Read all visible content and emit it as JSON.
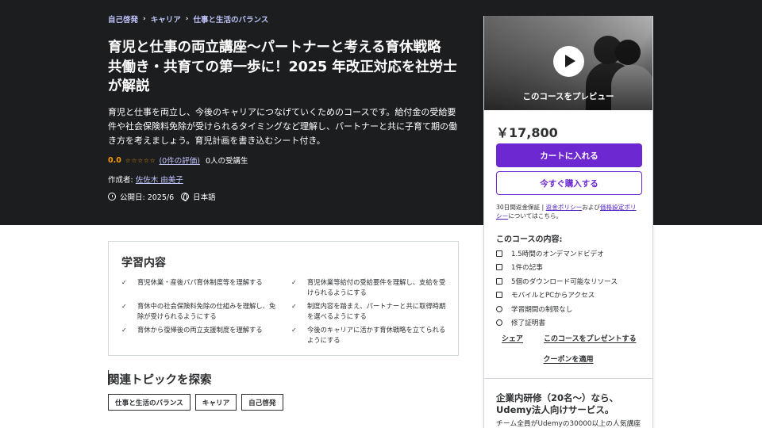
{
  "breadcrumb": [
    "自己啓発",
    "キャリア",
    "仕事と生活のバランス"
  ],
  "course": {
    "title": "育児と仕事の両立講座〜パートナーと考える育休戦略　共働き・共育ての第一歩に！2025 年改正対応を社労士が解説",
    "description": "育児と仕事を両立し、今後のキャリアにつなげていくためのコースです。給付金の受給要件や社会保険料免除が受けられるタイミングなど理解し、パートナーと共に子育て期の働き方を考えましょう。育児計画を書き込むシート付き。",
    "rating": "0.0",
    "stars": "☆☆☆☆☆",
    "rating_count": "(0件の評価)",
    "students": "0人の受講生",
    "author_label": "作成者: ",
    "author": "佐佐木 由美子",
    "published": "公開日: 2025/6",
    "language": "日本語"
  },
  "sidebar": {
    "preview_label": "このコースをプレビュー",
    "price": "￥17,800",
    "add_to_cart": "カートに入れる",
    "buy_now": "今すぐ購入する",
    "guarantee_prefix": "30日間返金保証 | ",
    "refund_policy": "返金ポリシー",
    "guarantee_mid": "および",
    "price_policy": "価格設定ポリシー",
    "guarantee_suffix": "についてはこちら。",
    "includes_title": "このコースの内容:",
    "includes": [
      {
        "icon": "video-icon",
        "text": "1.5時間のオンデマンドビデオ"
      },
      {
        "icon": "article-icon",
        "text": "1件の記事"
      },
      {
        "icon": "download-icon",
        "text": "5個のダウンロード可能なリソース"
      },
      {
        "icon": "mobile-icon",
        "text": "モバイルとPCからアクセス"
      },
      {
        "icon": "infinity-icon",
        "text": "学習期間の制限なし"
      },
      {
        "icon": "trophy-icon",
        "text": "修了証明書"
      }
    ],
    "share": "シェア",
    "gift": "このコースをプレゼントする",
    "coupon": "クーポンを適用",
    "biz_title": "企業内研修（20名〜）なら、Udemy法人向けサービス。",
    "biz_desc": "チーム全員がUdemyの30000以上の人気講座"
  },
  "learn": {
    "title": "学習内容",
    "items": [
      "育児休業・産後パパ育休制度等を理解する",
      "育児休業等給付の受給要件を理解し、支給を受けられるようにする",
      "育休中の社会保険料免除の仕組みを理解し、免除が受けられるようにする",
      "制度内容を踏まえ、パートナーと共に取得時期を選べるようにする",
      "育休から復帰後の両立支援制度を理解する",
      "今後のキャリアに活かす育休戦略を立てられるようにする"
    ]
  },
  "topics": {
    "title": "関連トピックを探索",
    "chips": [
      "仕事と生活のバランス",
      "キャリア",
      "自己啓発"
    ]
  }
}
